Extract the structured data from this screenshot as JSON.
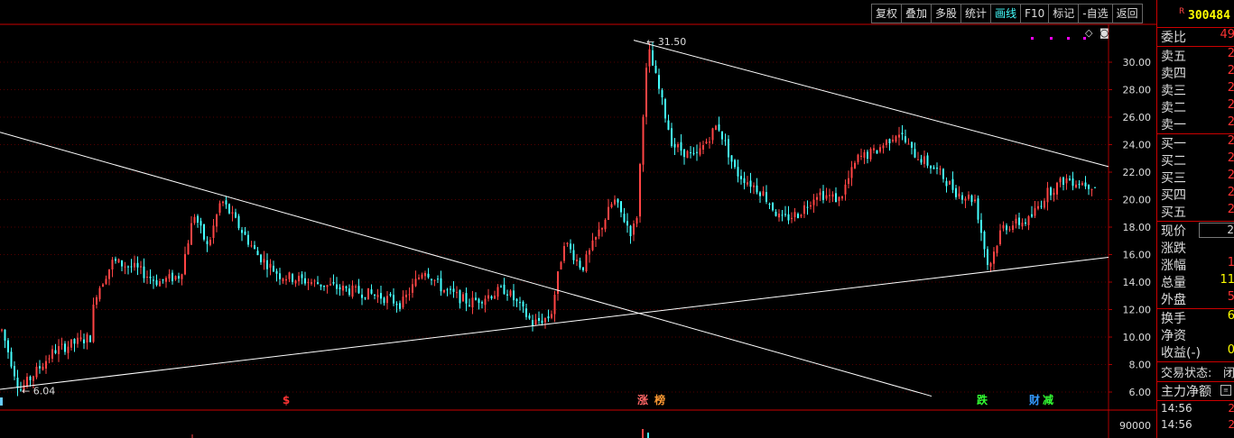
{
  "toolbar": {
    "buttons": [
      "复权",
      "叠加",
      "多股",
      "统计",
      "画线",
      "F10",
      "标记",
      "-自选",
      "返回"
    ],
    "active_index": 4
  },
  "chart_data": {
    "type": "candlestick",
    "y_ticks": [
      "30.00",
      "28.00",
      "26.00",
      "24.00",
      "22.00",
      "20.00",
      "18.00",
      "16.00",
      "14.00",
      "12.00",
      "10.00",
      "8.00",
      "6.00"
    ],
    "ylim": [
      5.5,
      32
    ],
    "volume_tick": "90000",
    "high_label": "31.50",
    "low_label": "6.04",
    "markers": [
      {
        "text": "$",
        "color": "#ff3333"
      },
      {
        "text": "涨",
        "color": "#ff6666"
      },
      {
        "text": "榜",
        "color": "#ff9933"
      },
      {
        "text": "跌",
        "color": "#33ff33"
      },
      {
        "text": "财",
        "color": "#3399ff"
      },
      {
        "text": "减",
        "color": "#33ff33"
      }
    ],
    "colors": {
      "up": "#ff4444",
      "down": "#44ffff",
      "grid": "#550000",
      "axis": "#aa0000",
      "line": "#ffffff"
    }
  },
  "quote": {
    "r_tag": "R",
    "code": "300484",
    "wei_bi": {
      "label": "委比",
      "value": "49"
    },
    "sell": [
      {
        "label": "卖五",
        "value": "2"
      },
      {
        "label": "卖四",
        "value": "2"
      },
      {
        "label": "卖三",
        "value": "2"
      },
      {
        "label": "卖二",
        "value": "2"
      },
      {
        "label": "卖一",
        "value": "2"
      }
    ],
    "buy": [
      {
        "label": "买一",
        "value": "2"
      },
      {
        "label": "买二",
        "value": "2"
      },
      {
        "label": "买三",
        "value": "2"
      },
      {
        "label": "买四",
        "value": "2"
      },
      {
        "label": "买五",
        "value": "2"
      }
    ],
    "stats": [
      {
        "label": "现价",
        "value": "2",
        "boxed": true
      },
      {
        "label": "涨跌",
        "value": ""
      },
      {
        "label": "涨幅",
        "value": "1"
      },
      {
        "label": "总量",
        "value": "11",
        "yellow": true
      },
      {
        "label": "外盘",
        "value": "5"
      }
    ],
    "extra": [
      {
        "label": "换手",
        "value": "6"
      },
      {
        "label": "净资",
        "value": ""
      },
      {
        "label": "收益(-)",
        "value": "0"
      }
    ],
    "trade_status": {
      "label": "交易状态:",
      "value": "闭"
    },
    "main_net": {
      "label": "主力净额"
    },
    "ticks": [
      {
        "time": "14:56",
        "value": "2"
      },
      {
        "time": "14:56",
        "value": "2"
      }
    ]
  }
}
